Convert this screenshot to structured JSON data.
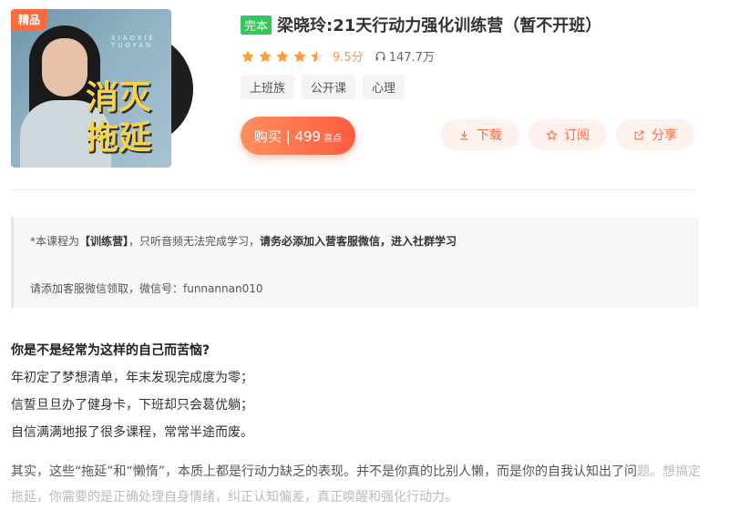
{
  "cover": {
    "tag": "精品",
    "brand_text": "XIAOXIE TUOYAN",
    "title_line1": "消灭",
    "title_line2": "拖延"
  },
  "header": {
    "complete_badge": "完本",
    "title": "梁晓玲:21天行动力强化训练营（暂不开班）",
    "rating_stars": 4.5,
    "score": "9.5分",
    "plays": "147.7万"
  },
  "tags": [
    "上班族",
    "公开课",
    "心理"
  ],
  "buy": {
    "label": "购买 | 499",
    "unit": "喜点"
  },
  "actions": {
    "download": "下载",
    "subscribe": "订阅",
    "share": "分享"
  },
  "notice": {
    "line1_prefix": "*本课程为",
    "line1_bold1": "【训练营】",
    "line1_mid": "，只听音频无法完成学习，",
    "line1_bold2": "请务必添加入营客服微信，进入社群学习",
    "line2": "请添加客服微信领取，微信号：funnannan010"
  },
  "content": {
    "question": "你是不是经常为这样的自己而苦恼?",
    "lines": [
      "年初定了梦想清单，年末发现完成度为零；",
      "信誓旦旦办了健身卡，下班却只会葛优躺；",
      "自信满满地报了很多课程，常常半途而废。"
    ],
    "para_visible": "其实，这些“拖延”和“懒惰”，本质上都是行动力缺乏的表现。并不是你真的比别人懒，而是你的自我认知出了问",
    "para_fade": "题。想搞定拖延，你需要的是正确处理自身情绪，纠正认知偏差，真正唤醒和强化行动力。"
  },
  "colors": {
    "accent": "#ff6a45",
    "star": "#ff9a3c",
    "complete": "#34c759"
  }
}
